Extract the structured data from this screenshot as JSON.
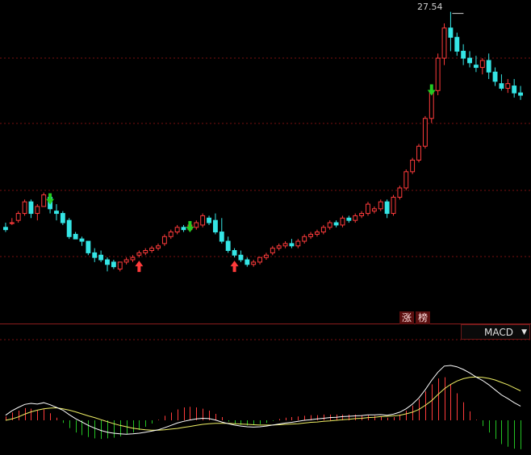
{
  "header_tags": {
    "zhang": "涨",
    "bang": "榜"
  },
  "indicator_select": {
    "label": "MACD",
    "caret": "▼"
  },
  "high_marker": {
    "label": "27.54"
  },
  "colors": {
    "up": "#ff3b3b",
    "down": "#35e5e5",
    "grid": "#7a1010",
    "macd_pos": "#ff3b3b",
    "macd_neg": "#23c323",
    "dif": "#ffffff",
    "dea": "#f0f066",
    "arrow_up": "#ff3b3b",
    "arrow_down": "#22cc22"
  },
  "chart_data": {
    "type": "candlestick",
    "y_high_label": 27.54,
    "candles": [
      [
        1,
        1.0,
        1.2,
        0.9,
        0.8
      ],
      [
        2,
        1.2,
        1.4,
        1.2,
        1.1
      ],
      [
        3,
        1.3,
        1.7,
        1.6,
        1.2
      ],
      [
        4,
        1.6,
        2.2,
        2.1,
        1.5
      ],
      [
        5,
        2.1,
        2.2,
        1.6,
        1.4
      ],
      [
        6,
        1.6,
        2.0,
        1.9,
        1.3
      ],
      [
        7,
        1.9,
        2.5,
        2.4,
        1.9
      ],
      [
        8,
        2.3,
        2.4,
        1.8,
        1.6
      ],
      [
        9,
        1.7,
        2.0,
        1.6,
        1.3
      ],
      [
        10,
        1.6,
        1.7,
        1.2,
        1.1
      ],
      [
        11,
        1.3,
        1.4,
        0.6,
        0.5
      ],
      [
        12,
        0.7,
        0.8,
        0.5,
        0.5
      ],
      [
        13,
        0.5,
        0.6,
        0.4,
        0.2
      ],
      [
        14,
        0.4,
        0.4,
        -0.1,
        -0.2
      ],
      [
        15,
        -0.1,
        0.1,
        -0.3,
        -0.5
      ],
      [
        16,
        -0.2,
        0.0,
        -0.4,
        -0.5
      ],
      [
        17,
        -0.4,
        -0.3,
        -0.6,
        -0.9
      ],
      [
        18,
        -0.5,
        -0.4,
        -0.7,
        -0.8
      ],
      [
        19,
        -0.8,
        -0.5,
        -0.5,
        -0.9
      ],
      [
        20,
        -0.5,
        -0.3,
        -0.4,
        -0.6
      ],
      [
        21,
        -0.4,
        -0.2,
        -0.3,
        -0.5
      ],
      [
        22,
        -0.2,
        0.0,
        -0.1,
        -0.3
      ],
      [
        23,
        -0.1,
        0.1,
        0.0,
        -0.2
      ],
      [
        24,
        0.0,
        0.2,
        0.1,
        -0.1
      ],
      [
        25,
        0.1,
        0.3,
        0.2,
        0.0
      ],
      [
        26,
        0.3,
        0.7,
        0.6,
        0.2
      ],
      [
        27,
        0.6,
        0.9,
        0.8,
        0.5
      ],
      [
        28,
        0.8,
        1.1,
        1.0,
        0.7
      ],
      [
        29,
        1.0,
        1.1,
        0.9,
        0.8
      ],
      [
        30,
        0.9,
        1.2,
        1.1,
        0.8
      ],
      [
        31,
        1.0,
        1.3,
        1.2,
        0.9
      ],
      [
        32,
        1.1,
        1.6,
        1.5,
        1.0
      ],
      [
        33,
        1.4,
        1.5,
        1.2,
        1.1
      ],
      [
        34,
        1.3,
        1.6,
        0.8,
        0.7
      ],
      [
        35,
        0.8,
        1.4,
        0.4,
        0.3
      ],
      [
        36,
        0.4,
        0.6,
        0.0,
        -0.1
      ],
      [
        37,
        0.0,
        0.1,
        -0.2,
        -0.3
      ],
      [
        38,
        -0.2,
        0.0,
        -0.4,
        -0.5
      ],
      [
        39,
        -0.4,
        -0.3,
        -0.6,
        -0.7
      ],
      [
        40,
        -0.6,
        -0.4,
        -0.5,
        -0.7
      ],
      [
        41,
        -0.5,
        -0.3,
        -0.3,
        -0.6
      ],
      [
        42,
        -0.3,
        -0.1,
        -0.2,
        -0.4
      ],
      [
        43,
        -0.1,
        0.2,
        0.1,
        -0.2
      ],
      [
        44,
        0.1,
        0.3,
        0.2,
        0.0
      ],
      [
        45,
        0.2,
        0.4,
        0.3,
        0.1
      ],
      [
        46,
        0.3,
        0.5,
        0.2,
        0.1
      ],
      [
        47,
        0.2,
        0.5,
        0.4,
        0.1
      ],
      [
        48,
        0.4,
        0.7,
        0.6,
        0.3
      ],
      [
        49,
        0.6,
        0.8,
        0.7,
        0.5
      ],
      [
        50,
        0.7,
        0.9,
        0.8,
        0.6
      ],
      [
        51,
        0.8,
        1.1,
        1.0,
        0.7
      ],
      [
        52,
        1.0,
        1.3,
        1.2,
        0.9
      ],
      [
        53,
        1.2,
        1.3,
        1.1,
        1.0
      ],
      [
        54,
        1.1,
        1.5,
        1.4,
        1.0
      ],
      [
        55,
        1.4,
        1.5,
        1.3,
        1.2
      ],
      [
        56,
        1.3,
        1.6,
        1.5,
        1.2
      ],
      [
        57,
        1.5,
        1.7,
        1.6,
        1.4
      ],
      [
        58,
        1.6,
        2.1,
        2.0,
        1.5
      ],
      [
        59,
        1.7,
        1.9,
        1.8,
        1.6
      ],
      [
        60,
        1.8,
        2.2,
        2.1,
        1.7
      ],
      [
        61,
        2.1,
        2.2,
        1.6,
        1.4
      ],
      [
        62,
        1.6,
        2.4,
        2.3,
        1.5
      ],
      [
        63,
        2.3,
        2.8,
        2.7,
        2.2
      ],
      [
        64,
        2.7,
        3.5,
        3.4,
        2.6
      ],
      [
        65,
        3.4,
        4.0,
        3.9,
        3.3
      ],
      [
        66,
        3.9,
        4.6,
        4.5,
        3.8
      ],
      [
        67,
        4.5,
        5.8,
        5.7,
        4.4
      ],
      [
        68,
        5.7,
        7.1,
        6.9,
        5.5
      ],
      [
        69,
        6.9,
        8.5,
        8.3,
        6.7
      ],
      [
        70,
        8.3,
        9.8,
        9.6,
        8.0
      ],
      [
        71,
        9.6,
        10.3,
        9.2,
        8.6
      ],
      [
        72,
        9.2,
        9.4,
        8.6,
        8.4
      ],
      [
        73,
        8.6,
        8.9,
        8.3,
        8.0
      ],
      [
        74,
        8.3,
        8.6,
        8.1,
        7.9
      ],
      [
        75,
        8.0,
        8.4,
        7.9,
        7.7
      ],
      [
        76,
        7.9,
        8.3,
        8.2,
        7.6
      ],
      [
        77,
        8.2,
        8.5,
        7.7,
        7.4
      ],
      [
        78,
        7.7,
        7.9,
        7.3,
        7.1
      ],
      [
        79,
        7.2,
        7.6,
        7.0,
        6.9
      ],
      [
        80,
        7.0,
        7.4,
        7.2,
        6.8
      ],
      [
        81,
        7.1,
        7.4,
        6.8,
        6.6
      ],
      [
        82,
        6.8,
        7.1,
        6.7,
        6.5
      ]
    ],
    "macd": [
      [
        1,
        0.15,
        0.0,
        0.12
      ],
      [
        2,
        0.28,
        0.04,
        0.24
      ],
      [
        3,
        0.38,
        0.1,
        0.3
      ],
      [
        4,
        0.47,
        0.18,
        0.38
      ],
      [
        5,
        0.5,
        0.25,
        0.36
      ],
      [
        6,
        0.48,
        0.3,
        0.3
      ],
      [
        7,
        0.52,
        0.34,
        0.34
      ],
      [
        8,
        0.46,
        0.36,
        0.22
      ],
      [
        9,
        0.38,
        0.37,
        0.08
      ],
      [
        10,
        0.3,
        0.34,
        -0.08
      ],
      [
        11,
        0.17,
        0.3,
        -0.24
      ],
      [
        12,
        0.05,
        0.25,
        -0.38
      ],
      [
        13,
        -0.05,
        0.19,
        -0.46
      ],
      [
        14,
        -0.15,
        0.13,
        -0.52
      ],
      [
        15,
        -0.23,
        0.08,
        -0.56
      ],
      [
        16,
        -0.3,
        0.02,
        -0.58
      ],
      [
        17,
        -0.35,
        -0.04,
        -0.56
      ],
      [
        18,
        -0.38,
        -0.1,
        -0.54
      ],
      [
        19,
        -0.4,
        -0.15,
        -0.5
      ],
      [
        20,
        -0.41,
        -0.19,
        -0.44
      ],
      [
        21,
        -0.4,
        -0.23,
        -0.38
      ],
      [
        22,
        -0.38,
        -0.26,
        -0.3
      ],
      [
        23,
        -0.35,
        -0.28,
        -0.2
      ],
      [
        24,
        -0.32,
        -0.29,
        -0.1
      ],
      [
        25,
        -0.28,
        -0.29,
        0.02
      ],
      [
        26,
        -0.22,
        -0.28,
        0.14
      ],
      [
        27,
        -0.15,
        -0.26,
        0.24
      ],
      [
        28,
        -0.08,
        -0.24,
        0.34
      ],
      [
        29,
        -0.03,
        -0.21,
        0.4
      ],
      [
        30,
        0.01,
        -0.18,
        0.42
      ],
      [
        31,
        0.04,
        -0.15,
        0.4
      ],
      [
        32,
        0.06,
        -0.12,
        0.36
      ],
      [
        33,
        0.05,
        -0.1,
        0.3
      ],
      [
        34,
        0.01,
        -0.09,
        0.2
      ],
      [
        35,
        -0.05,
        -0.09,
        0.1
      ],
      [
        36,
        -0.1,
        -0.09,
        -0.04
      ],
      [
        37,
        -0.14,
        -0.1,
        -0.1
      ],
      [
        38,
        -0.17,
        -0.11,
        -0.14
      ],
      [
        39,
        -0.19,
        -0.12,
        -0.16
      ],
      [
        40,
        -0.2,
        -0.13,
        -0.14
      ],
      [
        41,
        -0.19,
        -0.14,
        -0.12
      ],
      [
        42,
        -0.17,
        -0.14,
        -0.08
      ],
      [
        43,
        -0.14,
        -0.14,
        -0.02
      ],
      [
        44,
        -0.11,
        -0.13,
        0.04
      ],
      [
        45,
        -0.08,
        -0.12,
        0.08
      ],
      [
        46,
        -0.06,
        -0.11,
        0.1
      ],
      [
        47,
        -0.03,
        -0.1,
        0.12
      ],
      [
        48,
        0.0,
        -0.08,
        0.14
      ],
      [
        49,
        0.02,
        -0.06,
        0.16
      ],
      [
        50,
        0.04,
        -0.05,
        0.16
      ],
      [
        51,
        0.06,
        -0.03,
        0.18
      ],
      [
        52,
        0.08,
        -0.02,
        0.18
      ],
      [
        53,
        0.09,
        0.0,
        0.18
      ],
      [
        54,
        0.11,
        0.02,
        0.18
      ],
      [
        55,
        0.12,
        0.03,
        0.18
      ],
      [
        56,
        0.13,
        0.05,
        0.18
      ],
      [
        57,
        0.14,
        0.06,
        0.16
      ],
      [
        58,
        0.16,
        0.08,
        0.16
      ],
      [
        59,
        0.16,
        0.09,
        0.14
      ],
      [
        60,
        0.17,
        0.11,
        0.12
      ],
      [
        61,
        0.15,
        0.12,
        0.08
      ],
      [
        62,
        0.18,
        0.13,
        0.1
      ],
      [
        63,
        0.24,
        0.15,
        0.18
      ],
      [
        64,
        0.34,
        0.19,
        0.3
      ],
      [
        65,
        0.48,
        0.24,
        0.46
      ],
      [
        66,
        0.66,
        0.32,
        0.66
      ],
      [
        67,
        0.9,
        0.44,
        0.9
      ],
      [
        68,
        1.18,
        0.58,
        1.12
      ],
      [
        69,
        1.42,
        0.76,
        1.3
      ],
      [
        70,
        1.6,
        0.93,
        1.34
      ],
      [
        71,
        1.62,
        1.06,
        1.12
      ],
      [
        72,
        1.58,
        1.16,
        0.84
      ],
      [
        73,
        1.5,
        1.23,
        0.56
      ],
      [
        74,
        1.4,
        1.27,
        0.28
      ],
      [
        75,
        1.28,
        1.28,
        0.02
      ],
      [
        76,
        1.18,
        1.27,
        -0.18
      ],
      [
        77,
        1.05,
        1.24,
        -0.38
      ],
      [
        78,
        0.9,
        1.19,
        -0.58
      ],
      [
        79,
        0.75,
        1.12,
        -0.74
      ],
      [
        80,
        0.64,
        1.05,
        -0.82
      ],
      [
        81,
        0.52,
        0.96,
        -0.88
      ],
      [
        82,
        0.42,
        0.87,
        -0.9
      ]
    ],
    "signals": [
      {
        "bar": 8,
        "type": "sell"
      },
      {
        "bar": 22,
        "type": "buy"
      },
      {
        "bar": 30,
        "type": "sell"
      },
      {
        "bar": 37,
        "type": "buy"
      },
      {
        "bar": 68,
        "type": "sell"
      }
    ]
  }
}
